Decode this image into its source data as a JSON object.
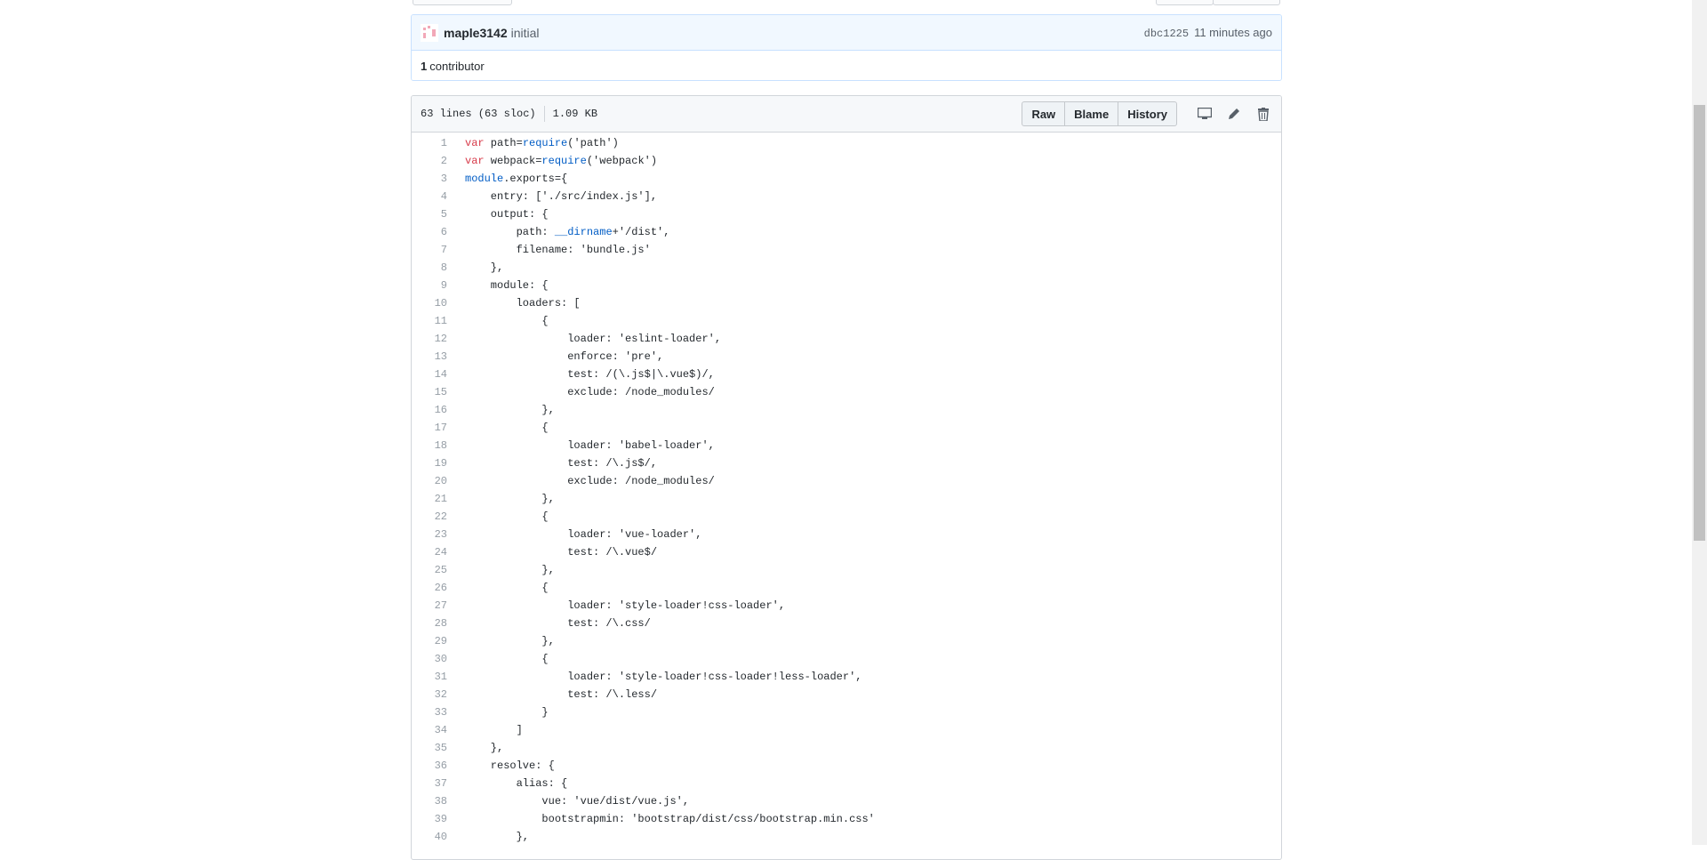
{
  "commit": {
    "author": "maple3142",
    "message": "initial",
    "sha": "dbc1225",
    "time": "11 minutes ago",
    "contributors_count": "1",
    "contributors_label": "contributor"
  },
  "file": {
    "lines_info": "63 lines (63 sloc)",
    "size": "1.09 KB",
    "raw_label": "Raw",
    "blame_label": "Blame",
    "history_label": "History"
  },
  "icons": {
    "desktop": "desktop-icon",
    "edit": "pencil-icon",
    "delete": "trash-icon"
  },
  "code_lines": [
    "var path=require('path')",
    "var webpack=require('webpack')",
    "module.exports={",
    "    entry: ['./src/index.js'],",
    "    output: {",
    "        path: __dirname+'/dist',",
    "        filename: 'bundle.js'",
    "    },",
    "    module: {",
    "        loaders: [",
    "            {",
    "                loader: 'eslint-loader',",
    "                enforce: 'pre',",
    "                test: /(\\.js$|\\.vue$)/,",
    "                exclude: /node_modules/",
    "            },",
    "            {",
    "                loader: 'babel-loader',",
    "                test: /\\.js$/,",
    "                exclude: /node_modules/",
    "            },",
    "            {",
    "                loader: 'vue-loader',",
    "                test: /\\.vue$/",
    "            },",
    "            {",
    "                loader: 'style-loader!css-loader',",
    "                test: /\\.css/",
    "            },",
    "            {",
    "                loader: 'style-loader!css-loader!less-loader',",
    "                test: /\\.less/",
    "            }",
    "        ]",
    "    },",
    "    resolve: {",
    "        alias: {",
    "            vue: 'vue/dist/vue.js',",
    "            bootstrapmin: 'bootstrap/dist/css/bootstrap.min.css'",
    "        },"
  ]
}
